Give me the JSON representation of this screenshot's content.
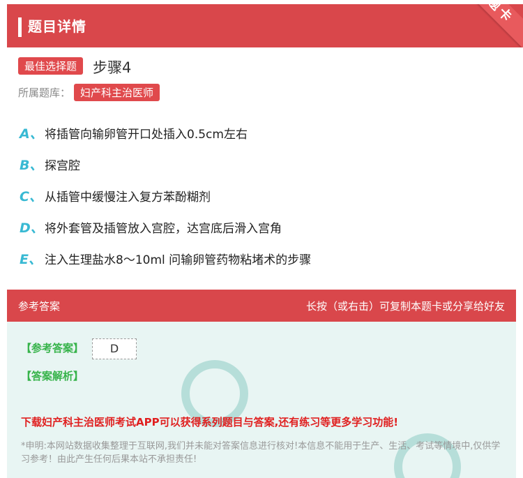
{
  "header": {
    "title": "题目详情",
    "corner_label": "题卡"
  },
  "question": {
    "type_badge": "最佳选择题",
    "title": "步骤4",
    "bank_label": "所属题库：",
    "bank_name": "妇产科主治医师",
    "options": [
      {
        "letter": "A、",
        "text": "将插管向输卵管开口处插入0.5cm左右"
      },
      {
        "letter": "B、",
        "text": "探宫腔"
      },
      {
        "letter": "C、",
        "text": "从插管中缓慢注入复方苯酚糊剂"
      },
      {
        "letter": "D、",
        "text": "将外套管及插管放入宫腔，达宫底后滑入宫角"
      },
      {
        "letter": "E、",
        "text": "注入生理盐水8～10ml 问输卵管药物粘堵术的步骤"
      }
    ]
  },
  "answer": {
    "bar_left": "参考答案",
    "bar_right": "长按（或右击）可复制本题卡或分享给好友",
    "ref_label": "【参考答案】",
    "ref_value": "D",
    "explain_label": "【答案解析】",
    "promo": "下载妇产科主治医师考试APP可以获得系列题目与答案,还有练习等更多学习功能!",
    "disclaimer": "*申明:本网站数据收集整理于互联网,我们并未能对答案信息进行核对!本信息不能用于生产、生活、考试等情境中,仅供学习参考！由此产生任何后果本站不承担责任!"
  },
  "colors": {
    "accent": "#d9474b",
    "option_letter": "#38b9d3",
    "answer_green": "#36b34a",
    "promo_red": "#e02020"
  }
}
